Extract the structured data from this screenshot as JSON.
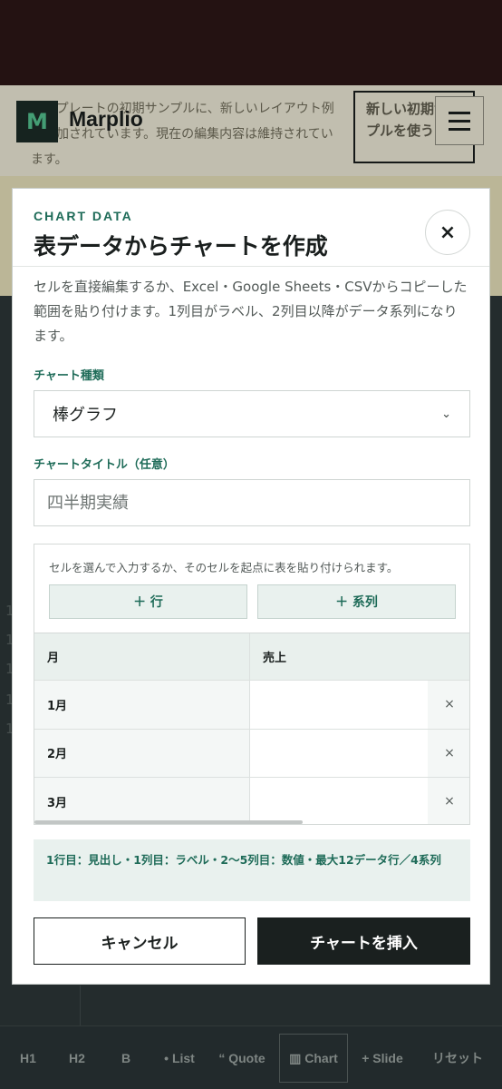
{
  "app": {
    "logo_letter": "M",
    "logo_name": "Marplio",
    "notice_text": "テンプレートの初期サンプルに、新しいレイアウト例が追加されています。現在の編集内容は維持されています。",
    "notice_button": "新しい初期サンプルを使う",
    "menu_icon": "hamburger-icon",
    "line_numbers": [
      "1",
      "1",
      "1",
      "1",
      "1"
    ]
  },
  "toolbar": {
    "items": [
      "H1",
      "H2",
      "B",
      "• List",
      "“ Quote",
      "▥ Chart",
      "+ Slide",
      "リセット"
    ]
  },
  "modal": {
    "eyebrow": "CHART DATA",
    "title": "表データからチャートを作成",
    "close_icon": "close-icon",
    "close_label": "×",
    "description": "セルを直接編集するか、Excel・Google Sheets・CSVからコピーした範囲を貼り付けます。1列目がラベル、2列目以降がデータ系列になります。",
    "chart_type_label": "チャート種類",
    "chart_type_value": "棒グラフ",
    "chart_type_icon": "chevron-down-icon",
    "chart_title_label": "チャートタイトル（任意）",
    "chart_title_placeholder": "四半期実績",
    "table_hint": "セルを選んで入力するか、そのセルを起点に表を貼り付けられます。",
    "add_row": "＋ 行",
    "add_series": "＋ 系列",
    "table": {
      "headers": [
        "月",
        "売上"
      ],
      "rows": [
        {
          "label": "1月",
          "value": "",
          "delete": "×"
        },
        {
          "label": "2月",
          "value": "",
          "delete": "×"
        },
        {
          "label": "3月",
          "value": "",
          "delete": "×"
        }
      ]
    },
    "note": "1行目：見出し・1列目：ラベル・2〜5列目：数値・最大12データ行／4系列",
    "cancel": "キャンセル",
    "insert": "チャートを挿入"
  }
}
